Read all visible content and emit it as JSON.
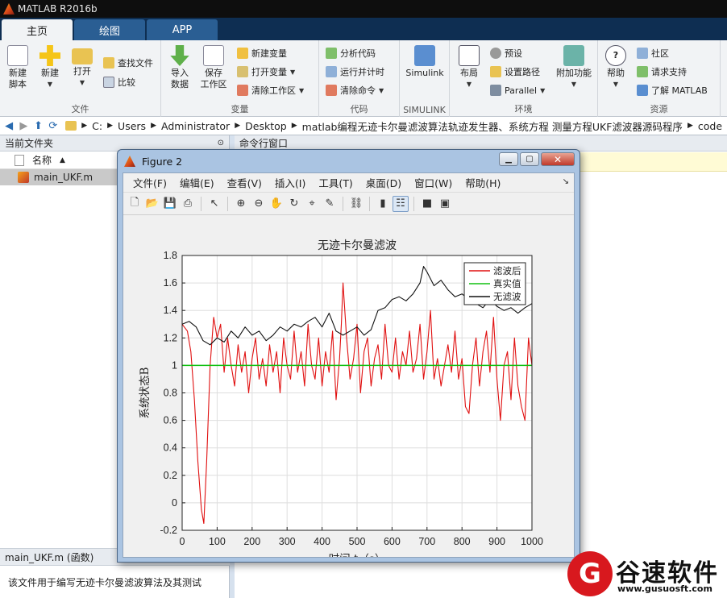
{
  "window": {
    "title": "MATLAB R2016b"
  },
  "ribbon_tabs": [
    {
      "label": "主页",
      "active": true
    },
    {
      "label": "绘图",
      "active": false
    },
    {
      "label": "APP",
      "active": false
    }
  ],
  "ribbon": {
    "file": {
      "label": "文件",
      "new_script": "新建\n脚本",
      "new": "新建",
      "open": "打开",
      "find_files": "查找文件",
      "compare": "比较"
    },
    "variable": {
      "label": "变量",
      "import_data": "导入\n数据",
      "save_workspace": "保存\n工作区",
      "new_variable": "新建变量",
      "open_variable": "打开变量",
      "clear_workspace": "清除工作区"
    },
    "code": {
      "label": "代码",
      "analyze_code": "分析代码",
      "run_and_time": "运行并计时",
      "clear_commands": "清除命令"
    },
    "simulink": {
      "label": "SIMULINK",
      "simulink": "Simulink"
    },
    "environment": {
      "label": "环境",
      "layout": "布局",
      "preferences": "预设",
      "set_path": "设置路径",
      "parallel": "Parallel",
      "addons": "附加功能"
    },
    "resources": {
      "label": "资源",
      "help": "帮助",
      "community": "社区",
      "request_support": "请求支持",
      "learn_matlab": "了解 MATLAB"
    }
  },
  "address_bar": {
    "crumbs": [
      "C:",
      "Users",
      "Administrator",
      "Desktop",
      "matlab编程无迹卡尔曼滤波算法轨迹发生器、系统方程 测量方程UKF滤波器源码程序",
      "code"
    ]
  },
  "current_folder": {
    "title": "当前文件夹",
    "column_name": "名称",
    "sort_indicator": "▲",
    "files": [
      {
        "name": "main_UKF.m"
      }
    ],
    "details_title": "main_UKF.m  (函数)",
    "details_text": "该文件用于编写无迹卡尔曼滤波算法及其测试"
  },
  "command_window": {
    "title": "命令行窗口"
  },
  "figure": {
    "title": "Figure 2",
    "menus": [
      "文件(F)",
      "编辑(E)",
      "查看(V)",
      "插入(I)",
      "工具(T)",
      "桌面(D)",
      "窗口(W)",
      "帮助(H)"
    ]
  },
  "chart_data": {
    "type": "line",
    "title": "无迹卡尔曼滤波",
    "xlabel": "时间 t（s）",
    "ylabel": "系统状态B",
    "xlim": [
      0,
      1000
    ],
    "ylim": [
      -0.2,
      1.8
    ],
    "xticks": [
      0,
      100,
      200,
      300,
      400,
      500,
      600,
      700,
      800,
      900,
      1000
    ],
    "yticks": [
      -0.2,
      0,
      0.2,
      0.4,
      0.6,
      0.8,
      1,
      1.2,
      1.4,
      1.6,
      1.8
    ],
    "grid": true,
    "legend_position": "top-right",
    "series": [
      {
        "name": "滤波后",
        "color": "#e01010",
        "x": [
          0,
          15,
          25,
          35,
          45,
          55,
          62,
          70,
          80,
          90,
          100,
          110,
          120,
          130,
          140,
          150,
          160,
          170,
          180,
          190,
          200,
          210,
          220,
          230,
          240,
          250,
          260,
          270,
          280,
          290,
          300,
          310,
          320,
          330,
          340,
          350,
          360,
          370,
          380,
          390,
          400,
          410,
          420,
          430,
          440,
          450,
          455,
          460,
          470,
          480,
          490,
          500,
          510,
          520,
          530,
          540,
          550,
          560,
          570,
          580,
          590,
          600,
          610,
          620,
          630,
          640,
          650,
          660,
          670,
          680,
          690,
          700,
          710,
          720,
          730,
          740,
          750,
          760,
          770,
          780,
          790,
          800,
          810,
          820,
          830,
          840,
          850,
          860,
          870,
          880,
          890,
          900,
          910,
          920,
          930,
          940,
          950,
          960,
          970,
          980,
          990,
          1000
        ],
        "y": [
          1.3,
          1.25,
          1.1,
          0.75,
          0.3,
          -0.05,
          -0.15,
          0.3,
          1.0,
          1.35,
          1.2,
          1.3,
          0.95,
          1.2,
          1.0,
          0.85,
          1.15,
          0.95,
          1.1,
          0.8,
          1.05,
          1.2,
          0.9,
          1.05,
          0.85,
          1.15,
          0.95,
          1.1,
          0.8,
          1.2,
          1.0,
          0.9,
          1.25,
          0.95,
          1.1,
          0.85,
          1.3,
          1.0,
          0.9,
          1.2,
          0.85,
          1.1,
          0.95,
          1.25,
          0.75,
          1.05,
          1.3,
          1.6,
          1.2,
          0.9,
          1.05,
          1.3,
          0.8,
          1.1,
          1.2,
          0.85,
          1.05,
          1.15,
          0.9,
          1.3,
          1.0,
          0.95,
          1.2,
          0.9,
          1.1,
          1.0,
          1.25,
          0.95,
          1.05,
          1.3,
          0.9,
          1.1,
          1.4,
          0.9,
          1.05,
          0.85,
          1.0,
          1.15,
          0.95,
          1.25,
          0.9,
          1.05,
          0.7,
          0.65,
          1.0,
          1.2,
          0.85,
          1.1,
          1.25,
          0.95,
          1.35,
          0.9,
          0.6,
          1.0,
          1.1,
          0.75,
          1.2,
          0.85,
          0.7,
          0.6,
          1.2,
          1.0
        ]
      },
      {
        "name": "真实值",
        "color": "#10c010",
        "x": [
          0,
          1000
        ],
        "y": [
          1,
          1
        ]
      },
      {
        "name": "无滤波",
        "color": "#111111",
        "x": [
          0,
          20,
          40,
          60,
          80,
          100,
          120,
          140,
          160,
          180,
          200,
          220,
          240,
          260,
          280,
          300,
          320,
          340,
          360,
          380,
          400,
          420,
          440,
          460,
          480,
          500,
          520,
          540,
          560,
          580,
          600,
          620,
          640,
          660,
          680,
          690,
          700,
          720,
          740,
          760,
          780,
          800,
          820,
          840,
          860,
          880,
          900,
          920,
          940,
          960,
          980,
          1000
        ],
        "y": [
          1.3,
          1.32,
          1.28,
          1.18,
          1.15,
          1.2,
          1.17,
          1.25,
          1.2,
          1.28,
          1.22,
          1.25,
          1.18,
          1.22,
          1.28,
          1.25,
          1.3,
          1.28,
          1.32,
          1.35,
          1.28,
          1.38,
          1.25,
          1.22,
          1.25,
          1.28,
          1.22,
          1.26,
          1.4,
          1.42,
          1.48,
          1.5,
          1.47,
          1.52,
          1.6,
          1.72,
          1.68,
          1.58,
          1.62,
          1.55,
          1.5,
          1.52,
          1.48,
          1.45,
          1.42,
          1.48,
          1.43,
          1.4,
          1.42,
          1.38,
          1.42,
          1.45
        ]
      }
    ]
  },
  "watermark": {
    "logo_letter": "G",
    "name": "谷速软件",
    "url": "www.gusuosft.com"
  }
}
